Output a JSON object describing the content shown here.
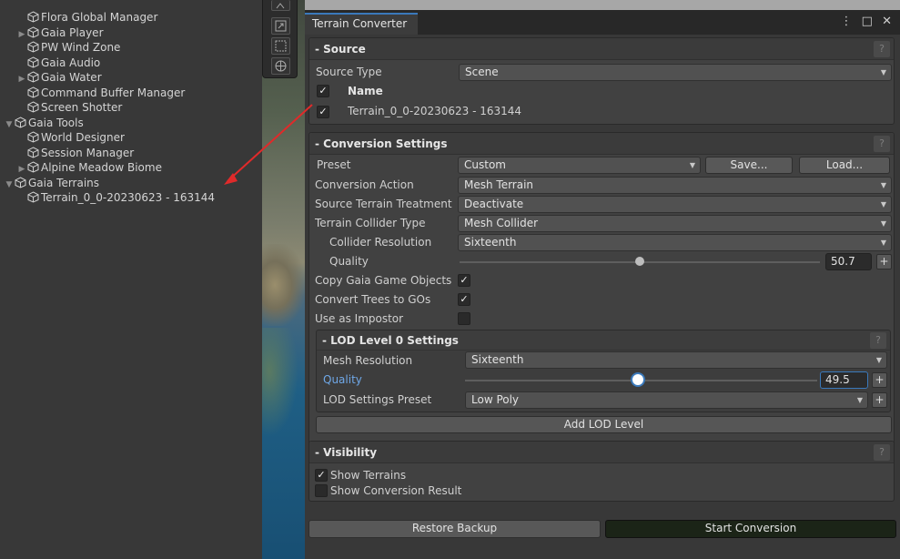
{
  "hierarchy": {
    "items": [
      {
        "label": "Flora Global Manager",
        "indent": 1,
        "expandable": false
      },
      {
        "label": "Gaia Player",
        "indent": 1,
        "expandable": true
      },
      {
        "label": "PW Wind Zone",
        "indent": 1,
        "expandable": false
      },
      {
        "label": "Gaia Audio",
        "indent": 1,
        "expandable": false
      },
      {
        "label": "Gaia Water",
        "indent": 1,
        "expandable": true
      },
      {
        "label": "Command Buffer Manager",
        "indent": 1,
        "expandable": false
      },
      {
        "label": "Screen Shotter",
        "indent": 1,
        "expandable": false
      },
      {
        "label": "Gaia Tools",
        "indent": 0,
        "expandable": true,
        "expanded": true
      },
      {
        "label": "World Designer",
        "indent": 1,
        "expandable": false
      },
      {
        "label": "Session Manager",
        "indent": 1,
        "expandable": false
      },
      {
        "label": "Alpine Meadow Biome",
        "indent": 1,
        "expandable": true
      },
      {
        "label": "Gaia Terrains",
        "indent": 0,
        "expandable": true,
        "expanded": true
      },
      {
        "label": "Terrain_0_0-20230623 - 163144",
        "indent": 1,
        "expandable": false
      }
    ]
  },
  "window": {
    "tab_title": "Terrain Converter",
    "controls": "⋮ □ ✕"
  },
  "source": {
    "header": "- Source",
    "help": "?",
    "source_type_label": "Source Type",
    "source_type_value": "Scene",
    "name_header": "Name",
    "name_header_checked": true,
    "terrain_name": "Terrain_0_0-20230623 - 163144",
    "terrain_checked": true
  },
  "conversion": {
    "header": "- Conversion Settings",
    "help": "?",
    "preset_label": "Preset",
    "preset_value": "Custom",
    "save_label": "Save...",
    "load_label": "Load...",
    "action_label": "Conversion Action",
    "action_value": "Mesh Terrain",
    "treatment_label": "Source Terrain Treatment",
    "treatment_value": "Deactivate",
    "collider_type_label": "Terrain Collider Type",
    "collider_type_value": "Mesh Collider",
    "collider_res_label": "Collider Resolution",
    "collider_res_value": "Sixteenth",
    "quality_label": "Quality",
    "quality_value": "50.7",
    "quality_fraction": 0.5,
    "plus_label": "+",
    "copy_gos_label": "Copy Gaia Game Objects",
    "copy_gos_checked": true,
    "convert_trees_label": "Convert Trees to GOs",
    "convert_trees_checked": true,
    "impostor_label": "Use as Impostor",
    "impostor_checked": false
  },
  "lod": {
    "header": "- LOD Level 0 Settings",
    "help": "?",
    "mesh_res_label": "Mesh Resolution",
    "mesh_res_value": "Sixteenth",
    "quality_label": "Quality",
    "quality_value": "49.5",
    "quality_fraction": 0.49,
    "preset_label": "LOD Settings Preset",
    "preset_value": "Low Poly",
    "plus_label": "+",
    "add_lod_label": "Add LOD Level"
  },
  "visibility": {
    "header": "- Visibility",
    "help": "?",
    "show_terrains_label": "Show Terrains",
    "show_terrains_checked": true,
    "show_result_label": "Show Conversion Result",
    "show_result_checked": false
  },
  "actions": {
    "restore_label": "Restore Backup",
    "start_label": "Start Conversion"
  },
  "colors": {
    "accent_blue": "#3a79bb",
    "link_blue": "#6fa8e8",
    "annotation_arrow": "#e02a2a",
    "start_button_bg": "#1b2417"
  }
}
